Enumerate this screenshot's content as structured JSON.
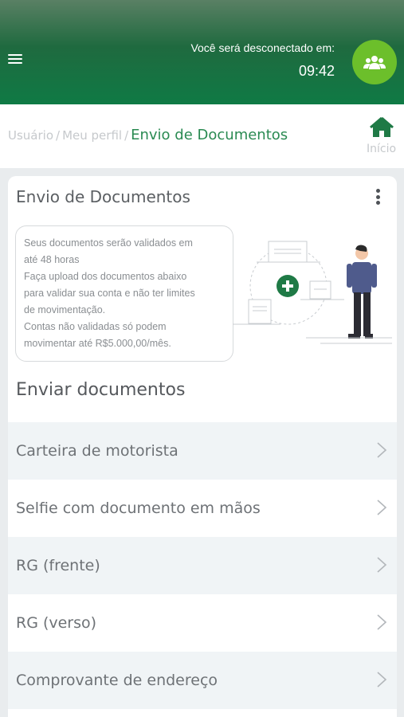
{
  "header": {
    "menu_icon": "hamburger-menu-icon",
    "logout_label": "Você será desconectado em:",
    "timer": "09:42",
    "group_icon": "user-group-icon",
    "colors": {
      "gradient_top": "#5a8064",
      "gradient_bottom": "#0f7a45",
      "accent": "#6cbf2b"
    }
  },
  "breadcrumb": {
    "items": [
      "Usuário",
      "Meu perfil",
      "Envio de Documentos"
    ],
    "home_icon": "home-icon",
    "home_label": "Início"
  },
  "card": {
    "title": "Envio de Documentos",
    "menu_icon": "kebab-menu-icon",
    "info_lines": [
      "Seus documentos serão validados em",
      "até 48 horas",
      "Faça upload dos documentos abaixo",
      "para validar sua conta e não ter limites",
      "de movimentação.",
      "Contas não validadas só podem",
      "movimentar até R$5.000,00/mês."
    ],
    "section_title": "Enviar documentos",
    "documents": [
      {
        "label": "Carteira de motorista"
      },
      {
        "label": "Selfie com documento em mãos"
      },
      {
        "label": "RG (frente)"
      },
      {
        "label": "RG (verso)"
      },
      {
        "label": "Comprovante de endereço"
      }
    ]
  }
}
